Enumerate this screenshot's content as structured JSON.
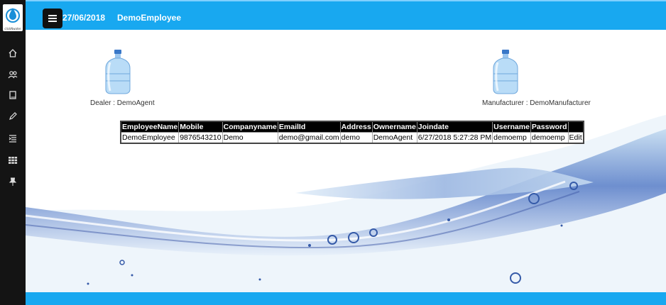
{
  "logo": {
    "text": "clickNwater"
  },
  "sidebar": {
    "items": [
      {
        "icon": "home-icon"
      },
      {
        "icon": "users-icon"
      },
      {
        "icon": "book-icon"
      },
      {
        "icon": "pencil-icon"
      },
      {
        "icon": "list-indent-icon"
      },
      {
        "icon": "grid-icon"
      },
      {
        "icon": "pin-icon"
      }
    ]
  },
  "header": {
    "menu_icon": "hamburger-menu-icon",
    "date": "27/06/2018",
    "user": "DemoEmployee"
  },
  "dealer": {
    "label": "Dealer : DemoAgent"
  },
  "manufacturer": {
    "label": "Manufacturer :  DemoManufacturer"
  },
  "table": {
    "headers": [
      "EmployeeName",
      "Mobile",
      "Companyname",
      "EmailId",
      "Address",
      "Ownername",
      "Joindate",
      "Username",
      "Password",
      ""
    ],
    "rows": [
      [
        "DemoEmployee",
        "9876543210",
        "Demo",
        "demo@gmail.com",
        "demo",
        "DemoAgent",
        "6/27/2018 5:27:28 PM",
        "demoemp",
        "demoemp",
        "Edit"
      ]
    ]
  },
  "colors": {
    "topbar": "#18a8f0",
    "sidebar": "#141414",
    "table_header": "#000000"
  }
}
